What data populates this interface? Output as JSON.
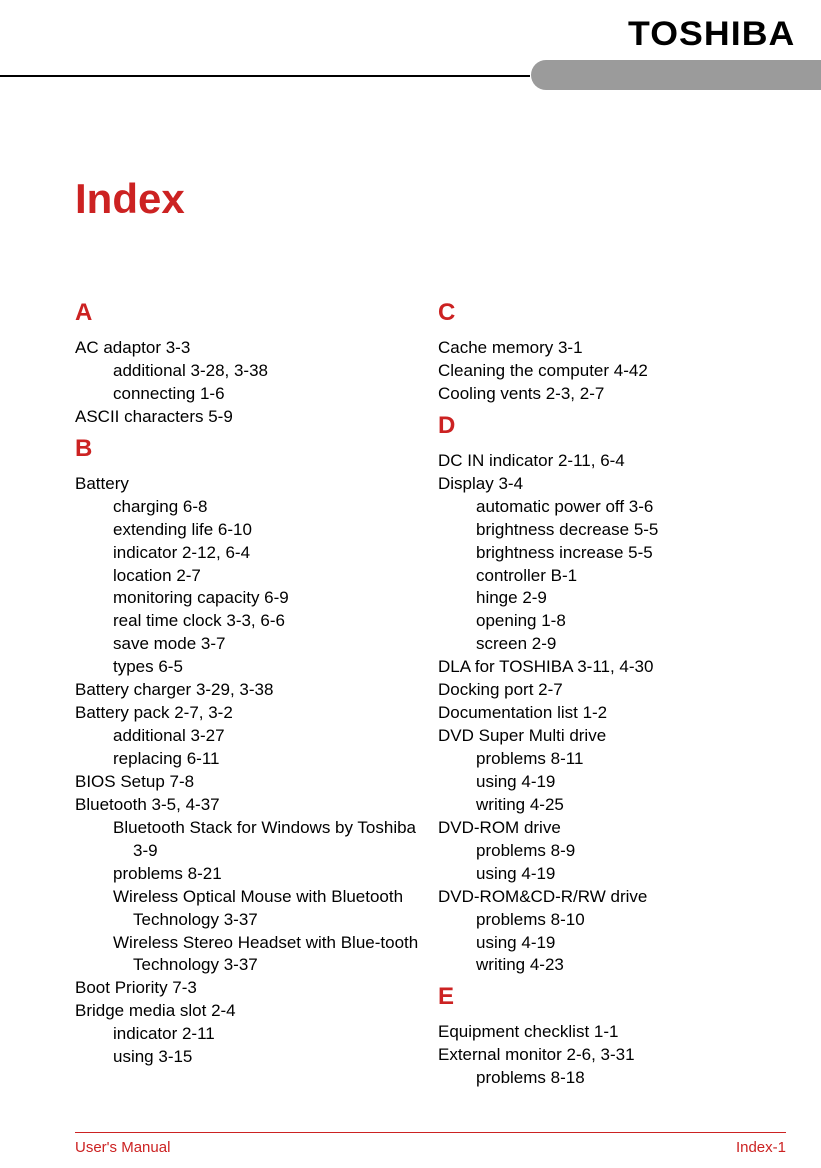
{
  "brand": "TOSHIBA",
  "page_title": "Index",
  "footer": {
    "left": "User's Manual",
    "right": "Index-1"
  },
  "left_column": {
    "sections": [
      {
        "letter": "A",
        "lines": [
          {
            "t": "AC adaptor 3-3",
            "lvl": 0
          },
          {
            "t": "additional 3-28, 3-38",
            "lvl": 1
          },
          {
            "t": "connecting 1-6",
            "lvl": 1
          },
          {
            "t": "ASCII characters 5-9",
            "lvl": 0
          }
        ]
      },
      {
        "letter": "B",
        "lines": [
          {
            "t": "Battery",
            "lvl": 0
          },
          {
            "t": "charging 6-8",
            "lvl": 1
          },
          {
            "t": "extending life 6-10",
            "lvl": 1
          },
          {
            "t": "indicator 2-12, 6-4",
            "lvl": 1
          },
          {
            "t": "location 2-7",
            "lvl": 1
          },
          {
            "t": "monitoring capacity 6-9",
            "lvl": 1
          },
          {
            "t": "real time clock 3-3, 6-6",
            "lvl": 1
          },
          {
            "t": "save mode 3-7",
            "lvl": 1
          },
          {
            "t": "types 6-5",
            "lvl": 1
          },
          {
            "t": "Battery charger 3-29, 3-38",
            "lvl": 0
          },
          {
            "t": "Battery pack 2-7, 3-2",
            "lvl": 0
          },
          {
            "t": "additional 3-27",
            "lvl": 1
          },
          {
            "t": "replacing 6-11",
            "lvl": 1
          },
          {
            "t": "BIOS Setup 7-8",
            "lvl": 0
          },
          {
            "t": "Bluetooth 3-5, 4-37",
            "lvl": 0
          },
          {
            "t": "Bluetooth Stack for Windows by Toshiba 3-9",
            "lvl": 2
          },
          {
            "t": "problems 8-21",
            "lvl": 1
          },
          {
            "t": "Wireless Optical Mouse with Bluetooth Technology 3-37",
            "lvl": 2
          },
          {
            "t": "Wireless Stereo Headset with Blue-tooth Technology 3-37",
            "lvl": 2
          },
          {
            "t": "Boot Priority 7-3",
            "lvl": 0
          },
          {
            "t": "Bridge media slot 2-4",
            "lvl": 0
          },
          {
            "t": "indicator 2-11",
            "lvl": 1
          },
          {
            "t": "using 3-15",
            "lvl": 1
          }
        ]
      }
    ]
  },
  "right_column": {
    "sections": [
      {
        "letter": "C",
        "lines": [
          {
            "t": "Cache memory 3-1",
            "lvl": 0
          },
          {
            "t": "Cleaning the computer 4-42",
            "lvl": 0
          },
          {
            "t": "Cooling vents 2-3, 2-7",
            "lvl": 0
          }
        ]
      },
      {
        "letter": "D",
        "lines": [
          {
            "t": "DC IN indicator 2-11, 6-4",
            "lvl": 0
          },
          {
            "t": "Display 3-4",
            "lvl": 0
          },
          {
            "t": "automatic power off 3-6",
            "lvl": 1
          },
          {
            "t": "brightness decrease 5-5",
            "lvl": 1
          },
          {
            "t": "brightness increase 5-5",
            "lvl": 1
          },
          {
            "t": "controller B-1",
            "lvl": 1
          },
          {
            "t": "hinge 2-9",
            "lvl": 1
          },
          {
            "t": "opening 1-8",
            "lvl": 1
          },
          {
            "t": "screen 2-9",
            "lvl": 1
          },
          {
            "t": "DLA for TOSHIBA 3-11, 4-30",
            "lvl": 0
          },
          {
            "t": "Docking port 2-7",
            "lvl": 0
          },
          {
            "t": "Documentation list 1-2",
            "lvl": 0
          },
          {
            "t": "DVD Super Multi drive",
            "lvl": 0
          },
          {
            "t": "problems 8-11",
            "lvl": 1
          },
          {
            "t": "using 4-19",
            "lvl": 1
          },
          {
            "t": "writing 4-25",
            "lvl": 1
          },
          {
            "t": "DVD-ROM drive",
            "lvl": 0
          },
          {
            "t": "problems 8-9",
            "lvl": 1
          },
          {
            "t": "using 4-19",
            "lvl": 1
          },
          {
            "t": "DVD-ROM&CD-R/RW drive",
            "lvl": 0
          },
          {
            "t": "problems 8-10",
            "lvl": 1
          },
          {
            "t": "using 4-19",
            "lvl": 1
          },
          {
            "t": "writing 4-23",
            "lvl": 1
          }
        ]
      },
      {
        "letter": "E",
        "lines": [
          {
            "t": "Equipment checklist 1-1",
            "lvl": 0
          },
          {
            "t": "External monitor 2-6, 3-31",
            "lvl": 0
          },
          {
            "t": "problems 8-18",
            "lvl": 1
          }
        ]
      }
    ]
  }
}
